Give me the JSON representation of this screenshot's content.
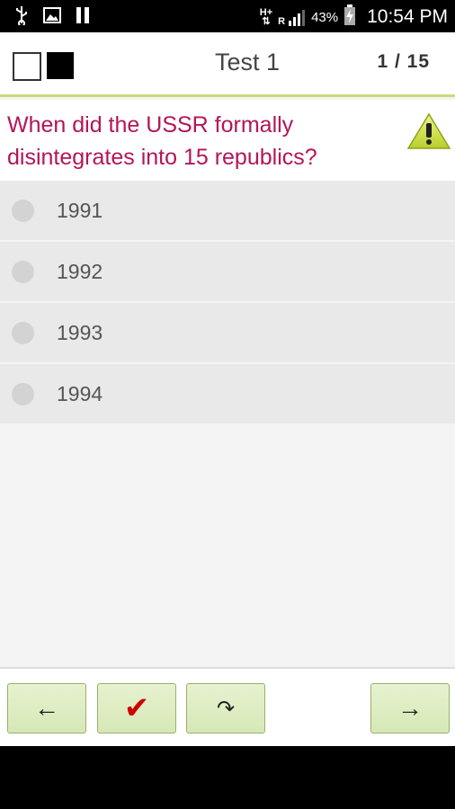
{
  "status_bar": {
    "net_top": "H+",
    "net_bottom": "R",
    "battery": "43%",
    "time": "10:54 PM"
  },
  "header": {
    "title": "Test 1",
    "counter": "1 / 15"
  },
  "question": {
    "text": "When did the USSR formally disintegrates into 15 republics?"
  },
  "answers": [
    {
      "label": "1991"
    },
    {
      "label": "1992"
    },
    {
      "label": "1993"
    },
    {
      "label": "1994"
    }
  ],
  "toolbar": {
    "prev_icon": "←",
    "check_icon": "✔",
    "redo_icon": "↷",
    "next_icon": "→"
  }
}
